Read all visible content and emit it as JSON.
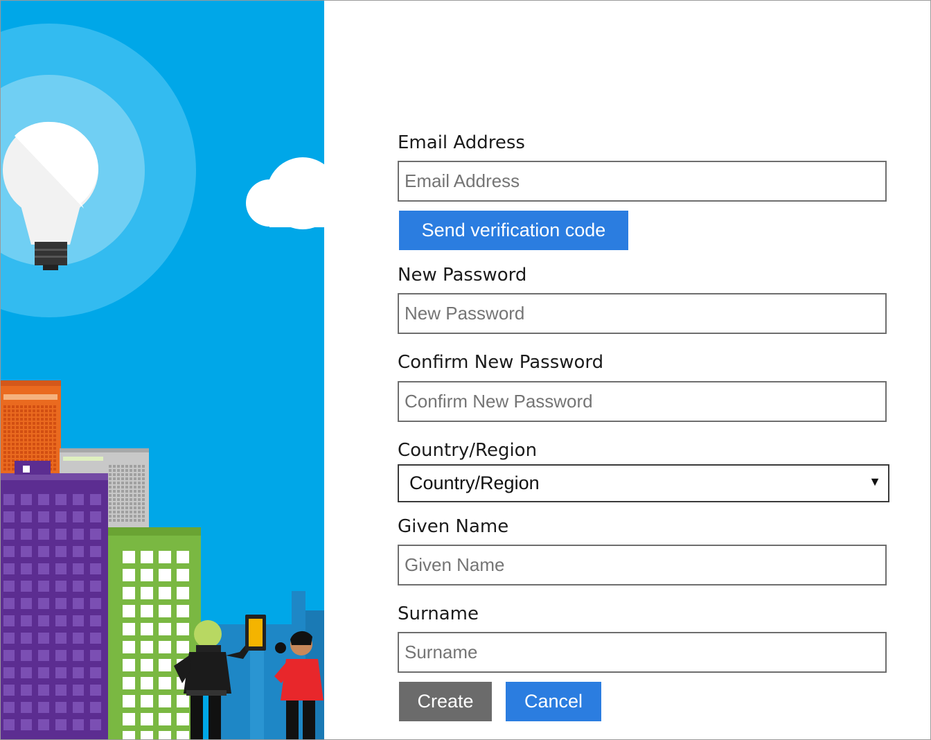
{
  "form": {
    "email": {
      "label": "Email Address",
      "placeholder": "Email Address",
      "value": ""
    },
    "send_code_label": "Send verification code",
    "new_password": {
      "label": "New Password",
      "placeholder": "New Password",
      "value": ""
    },
    "confirm_password": {
      "label": "Confirm New Password",
      "placeholder": "Confirm New Password",
      "value": ""
    },
    "country": {
      "label": "Country/Region",
      "selected": "Country/Region"
    },
    "given_name": {
      "label": "Given Name",
      "placeholder": "Given Name",
      "value": ""
    },
    "surname": {
      "label": "Surname",
      "placeholder": "Surname",
      "value": ""
    },
    "create_label": "Create",
    "cancel_label": "Cancel"
  },
  "colors": {
    "sky": "#00a7e8",
    "primary_button": "#2b7de0",
    "secondary_button": "#6b6b6b",
    "input_border": "#6e6e6e"
  },
  "icons": {
    "dropdown": "caret-down-icon"
  }
}
